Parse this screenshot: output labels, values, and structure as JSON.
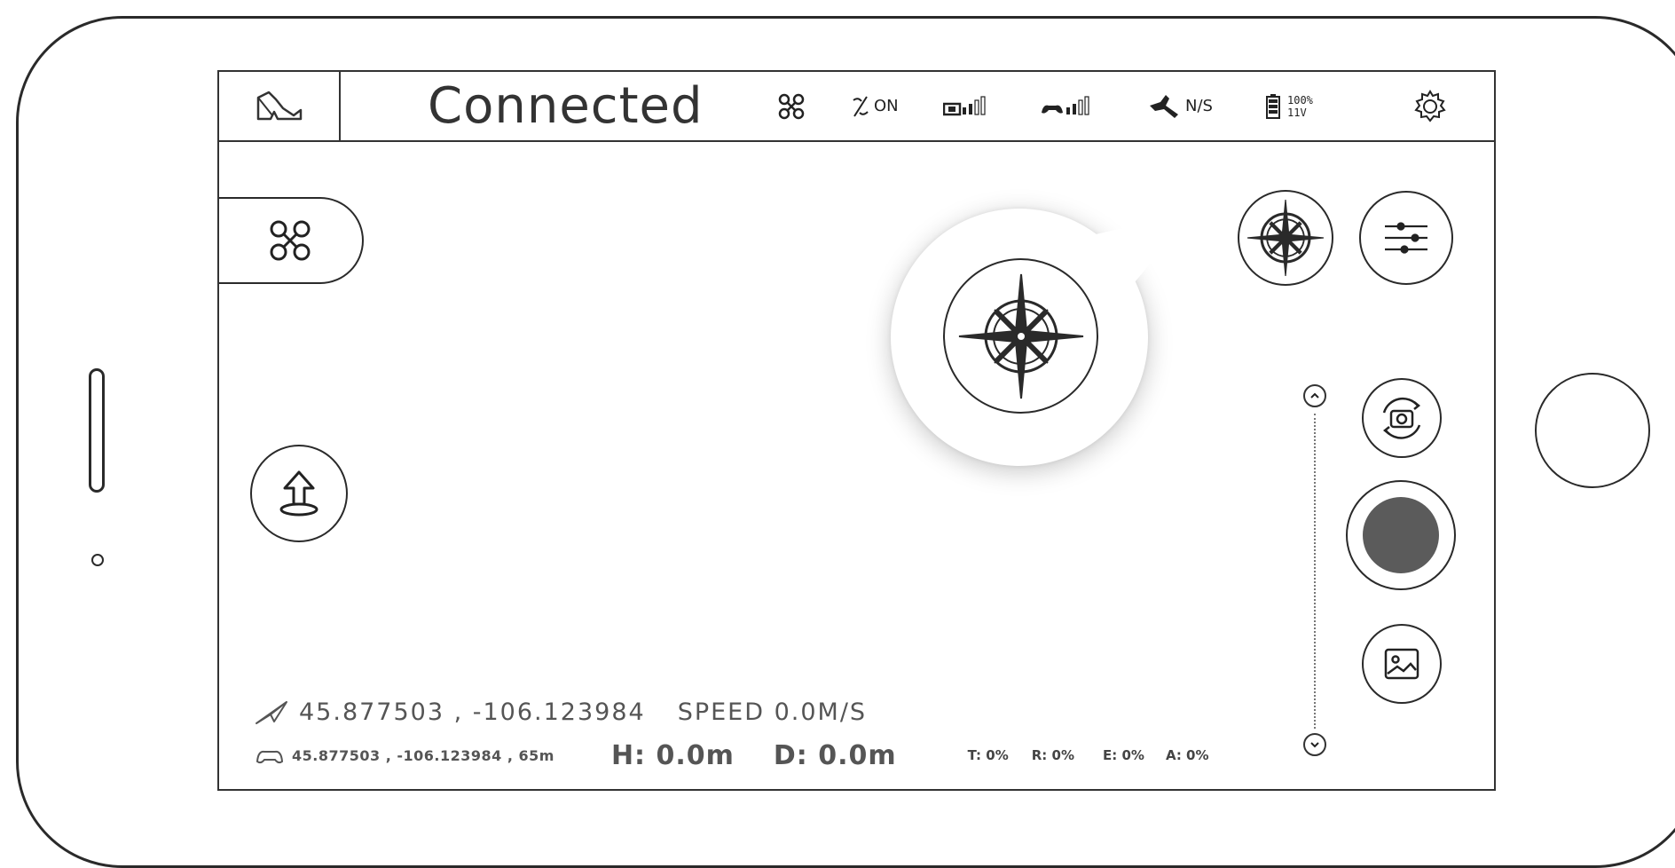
{
  "topbar": {
    "status": "Connected",
    "gps_on_label": "ON",
    "gps_satellite_label": "N/S",
    "battery_percent": "100%",
    "battery_voltage": "11V",
    "remote_signal_bars": 3,
    "video_signal_bars": 3
  },
  "telemetry": {
    "drone_coords": "45.877503 , -106.123984",
    "speed": "SPEED 0.0M/S",
    "controller_coords": "45.877503 , -106.123984 , 65m",
    "height": "H: 0.0m",
    "distance": "D: 0.0m",
    "trim_t": "T: 0%",
    "trim_r": "R: 0%",
    "trim_e": "E: 0%",
    "trim_a": "A: 0%"
  },
  "icons": {
    "map": "map-icon",
    "drone": "drone-icon",
    "gps": "gps-icon",
    "video_signal": "video-signal-icon",
    "remote_signal": "remote-signal-icon",
    "satellite": "satellite-icon",
    "battery": "battery-icon",
    "settings": "gear-icon",
    "compass": "compass-icon",
    "sliders": "sliders-icon",
    "takeoff": "takeoff-icon",
    "camera_switch": "camera-switch-icon",
    "record": "record-icon",
    "gallery": "gallery-icon"
  },
  "colors": {
    "record_fill": "#5b5b5b",
    "line": "#2a2a2a"
  }
}
